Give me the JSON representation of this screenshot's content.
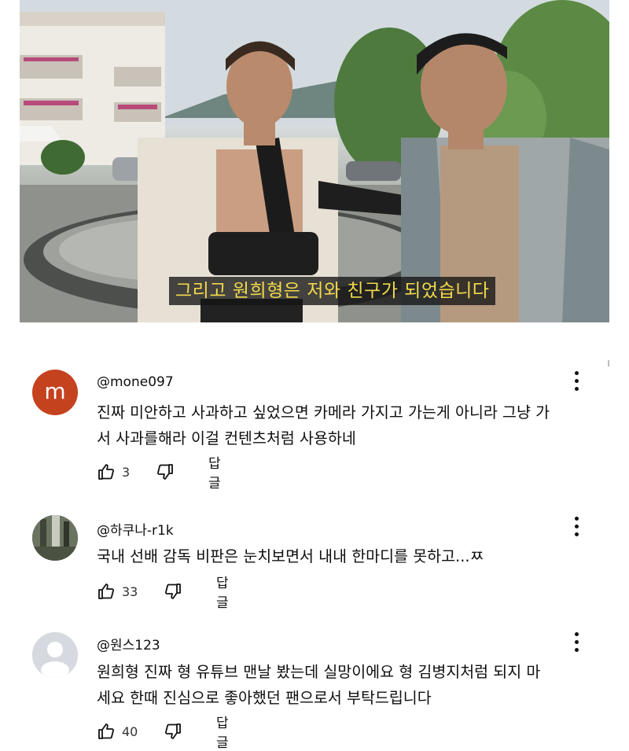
{
  "video": {
    "subtitle": "그리고 원희형은 저와 친구가 되었습니다"
  },
  "comments": [
    {
      "avatar_letter": "m",
      "avatar_color": "#c5421f",
      "handle": "@mone097",
      "text_line1": "진짜 미안하고 사과하고 싶었으면 카메라 가지고 가는게 아니라 그냥 가",
      "text_line2": "서 사과를해라 이걸 컨텐츠처럼 사용하네",
      "likes": "3",
      "reply_label": "답글"
    },
    {
      "avatar_type": "photo",
      "handle": "@하쿠나-r1k",
      "text_line1": "국내 선배 감독 비판은 눈치보면서 내내 한마디를 못하고...ㅉ",
      "likes": "33",
      "reply_label": "답글"
    },
    {
      "avatar_type": "default",
      "handle": "@원스123",
      "text_line1": "원희형 진짜 형 유튜브 맨날 봤는데 실망이에요 형 김병지처럼 되지 마",
      "text_line2": "세요 한때 진심으로 좋아했던 팬으로서 부탁드립니다",
      "likes": "40",
      "reply_label": "답글"
    }
  ],
  "icons": [
    "thumbs-up-icon",
    "thumbs-down-icon",
    "more-vert-icon",
    "person-icon"
  ]
}
